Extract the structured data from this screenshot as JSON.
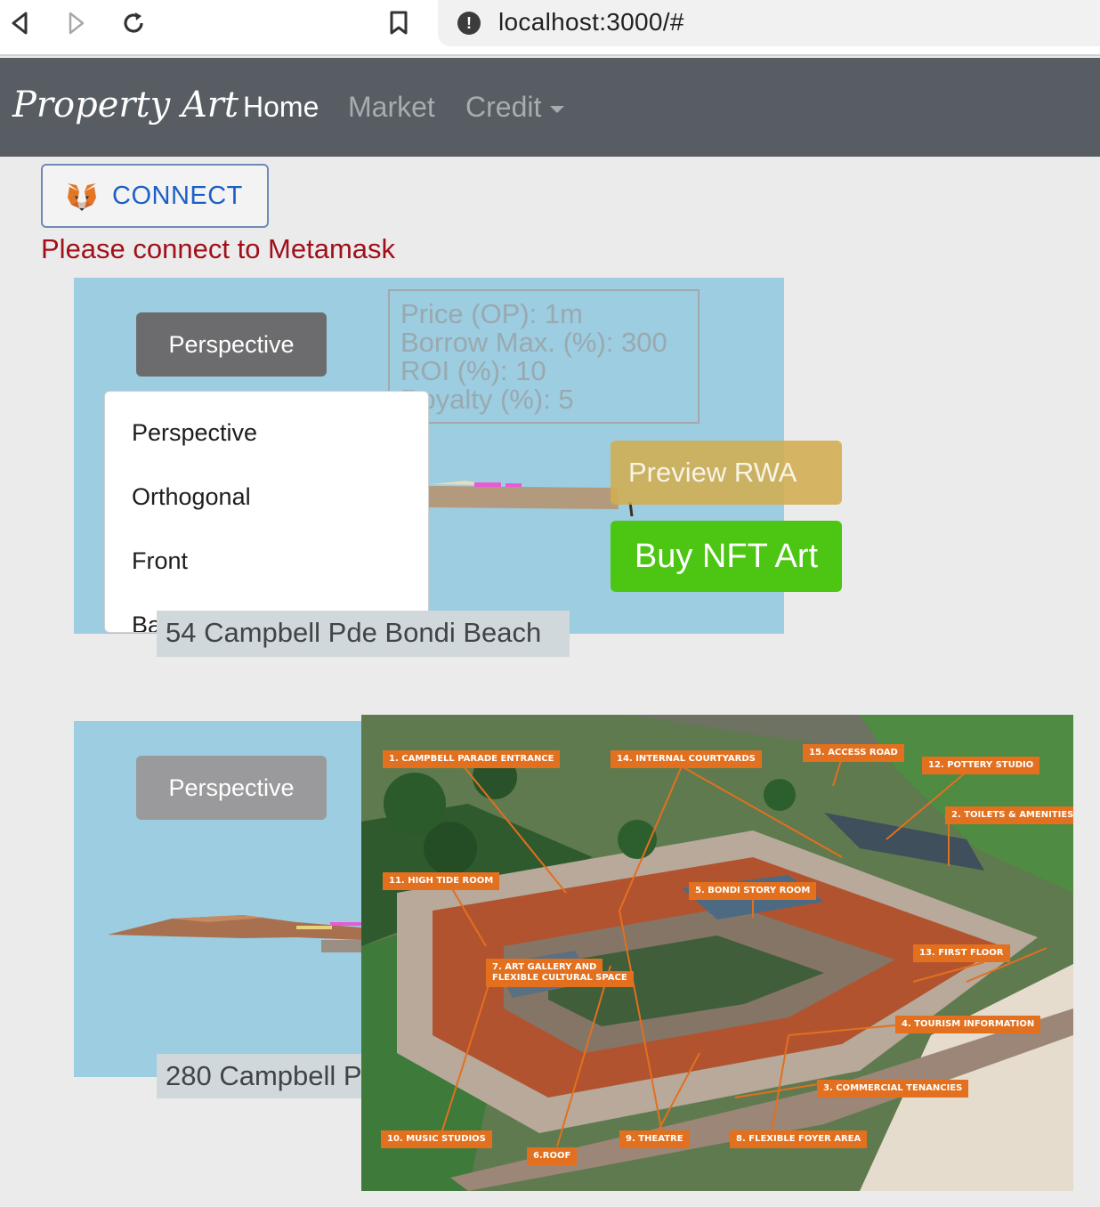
{
  "browser": {
    "url": "localhost:3000/#",
    "back_icon": "back-arrow-icon",
    "forward_icon": "forward-arrow-icon",
    "reload_icon": "reload-icon",
    "bookmark_icon": "bookmark-icon",
    "site_info_icon": "site-info-icon"
  },
  "navbar": {
    "brand": "Property Art",
    "links": [
      {
        "label": "Home",
        "active": true
      },
      {
        "label": "Market",
        "active": false
      },
      {
        "label": "Credit",
        "active": false,
        "dropdown": true
      }
    ]
  },
  "connect": {
    "label": "CONNECT",
    "icon": "metamask-fox-icon",
    "warning": "Please connect to Metamask"
  },
  "cards": [
    {
      "view_button": "Perspective",
      "info": {
        "price": "Price (OP): 1m",
        "borrow": "Borrow Max. (%): 300",
        "roi": "ROI (%): 10",
        "royalty": "Royalty (%): 5"
      },
      "view_options": [
        "Perspective",
        "Orthogonal",
        "Front",
        "Back"
      ],
      "address": "54 Campbell Pde Bondi Beach",
      "preview_button": "Preview RWA",
      "buy_button": "Buy NFT Art"
    },
    {
      "view_button": "Perspective",
      "address": "280 Campbell P"
    }
  ],
  "photo": {
    "labels": [
      "1. CAMPBELL PARADE ENTRANCE",
      "14. INTERNAL COURTYARDS",
      "15. ACCESS ROAD",
      "12. POTTERY STUDIO",
      "2. TOILETS & AMENITIES",
      "11. HIGH TIDE ROOM",
      "5. BONDI STORY ROOM",
      "13. FIRST FLOOR",
      "7. ART GALLERY AND",
      "FLEXIBLE CULTURAL SPACE",
      "4. TOURISM INFORMATION",
      "3. COMMERCIAL TENANCIES",
      "10. MUSIC STUDIOS",
      "9. THEATRE",
      "8. FLEXIBLE FOYER AREA",
      "6.ROOF"
    ]
  },
  "colors": {
    "navbar": "#575d63",
    "card_bg": "#9ccde0",
    "buy": "#4cc612",
    "preview": "#d2ad50",
    "warning": "#a0101b",
    "label_tag": "#e2701e"
  }
}
